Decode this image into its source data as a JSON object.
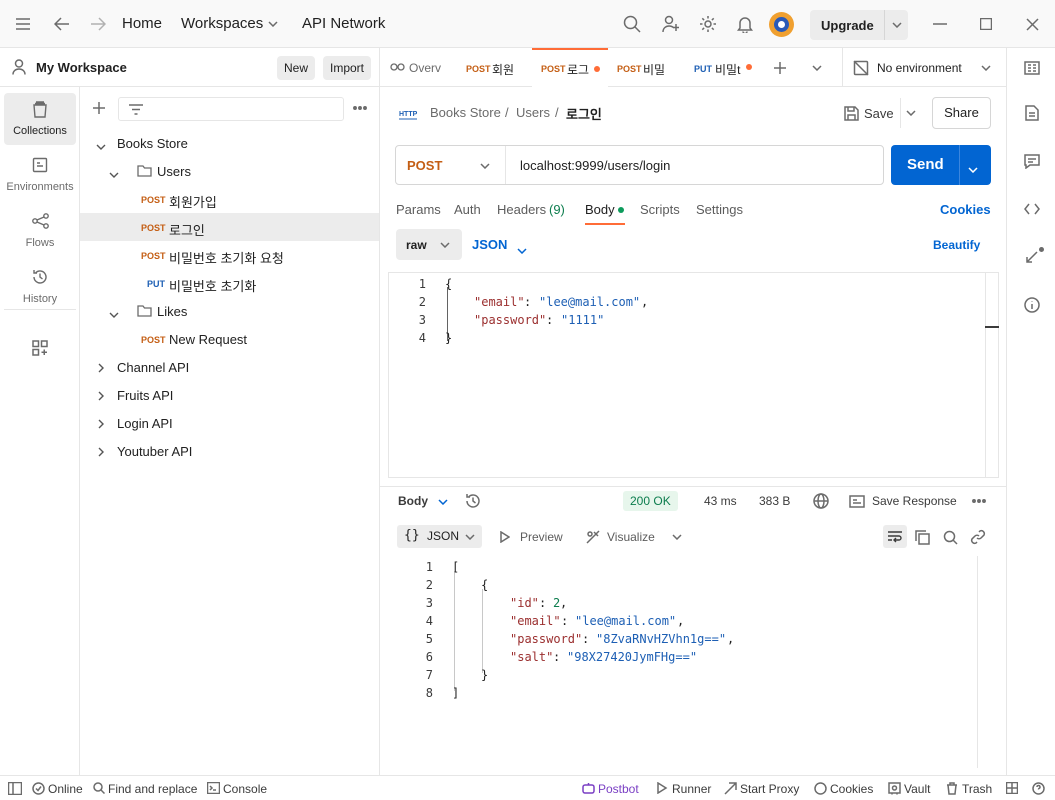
{
  "topbar": {
    "home": "Home",
    "workspaces": "Workspaces",
    "api_network": "API Network",
    "upgrade": "Upgrade"
  },
  "workspace": {
    "name": "My Workspace",
    "new_label": "New",
    "import_label": "Import"
  },
  "rail": {
    "collections": "Collections",
    "environments": "Environments",
    "flows": "Flows",
    "history": "History"
  },
  "tree": {
    "root": "Books Store",
    "users_folder": "Users",
    "items": [
      {
        "method": "POST",
        "label": "회원가입"
      },
      {
        "method": "POST",
        "label": "로그인"
      },
      {
        "method": "POST",
        "label": "비밀번호 초기화 요청"
      },
      {
        "method": "PUT",
        "label": "비밀번호 초기화"
      }
    ],
    "likes_folder": "Likes",
    "likes_item": {
      "method": "POST",
      "label": "New Request"
    },
    "collections": [
      "Channel API",
      "Fruits API",
      "Login API",
      "Youtuber API"
    ]
  },
  "tabs": [
    {
      "method": "",
      "label": "Overv"
    },
    {
      "method": "POST",
      "label": "회원"
    },
    {
      "method": "POST",
      "label": "로그"
    },
    {
      "method": "POST",
      "label": "비밀"
    },
    {
      "method": "PUT",
      "label": "비밀t"
    }
  ],
  "environment": "No environment",
  "breadcrumb": {
    "collection": "Books Store",
    "folder": "Users",
    "request": "로그인",
    "sep": "/"
  },
  "actions": {
    "save": "Save",
    "share": "Share",
    "send": "Send"
  },
  "request": {
    "method": "POST",
    "url": "localhost:9999/users/login"
  },
  "request_tabs": {
    "params": "Params",
    "auth": "Auth",
    "headers": "Headers",
    "headers_count": "(9)",
    "body": "Body",
    "scripts": "Scripts",
    "settings": "Settings",
    "cookies": "Cookies"
  },
  "body_options": {
    "mode": "raw",
    "format": "JSON",
    "beautify": "Beautify"
  },
  "request_body_lines": [
    {
      "n": "1",
      "text": "{"
    },
    {
      "n": "2",
      "key": "\"email\"",
      "sep": ": ",
      "val": "\"lee@mail.com\"",
      "end": ","
    },
    {
      "n": "3",
      "key": "\"password\"",
      "sep": ": ",
      "val": "\"1111\"",
      "end": ""
    },
    {
      "n": "4",
      "text": "}"
    }
  ],
  "response": {
    "body_label": "Body",
    "status": "200 OK",
    "time": "43 ms",
    "size": "383 B",
    "save_response": "Save Response",
    "format": "JSON",
    "preview": "Preview",
    "visualize": "Visualize"
  },
  "response_lines": [
    {
      "n": "1",
      "text": "["
    },
    {
      "n": "2",
      "text": "{"
    },
    {
      "n": "3",
      "key": "\"id\"",
      "val": "2",
      "type": "num",
      "end": ","
    },
    {
      "n": "4",
      "key": "\"email\"",
      "val": "\"lee@mail.com\"",
      "type": "str",
      "end": ","
    },
    {
      "n": "5",
      "key": "\"password\"",
      "val": "\"8ZvaRNvHZVhn1g==\"",
      "type": "str",
      "end": ","
    },
    {
      "n": "6",
      "key": "\"salt\"",
      "val": "\"98X27420JymFHg==\"",
      "type": "str",
      "end": ""
    },
    {
      "n": "7",
      "text": "}"
    },
    {
      "n": "8",
      "text": "]"
    }
  ],
  "status_bar": {
    "online": "Online",
    "find_replace": "Find and replace",
    "console": "Console",
    "postbot": "Postbot",
    "runner": "Runner",
    "start_proxy": "Start Proxy",
    "cookies": "Cookies",
    "vault": "Vault",
    "trash": "Trash"
  },
  "colors": {
    "accent": "#ff6c37",
    "send": "#0265d2",
    "post": "#c45e14",
    "put": "#1d5fb4",
    "ok_bg": "#e7f6ec",
    "ok_text": "#0d7d4e"
  }
}
